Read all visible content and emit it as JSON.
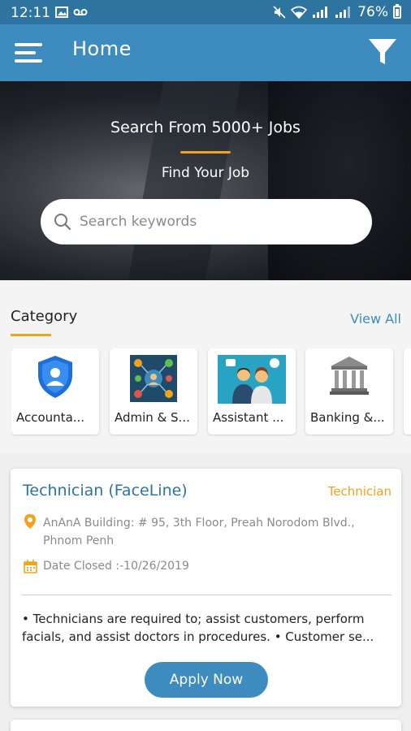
{
  "status_bar": {
    "time": "12:11",
    "battery": "76%",
    "icons": [
      "image-icon",
      "voicemail-icon",
      "mute-icon",
      "wifi-icon",
      "signal-icon",
      "battery-icon"
    ]
  },
  "app_bar": {
    "title": "Home",
    "menu_icon": "hamburger-icon",
    "filter_icon": "filter-icon",
    "color": "#3d8bbf"
  },
  "hero": {
    "title": "Search From 5000+ Jobs",
    "subtitle": "Find Your Job",
    "accent": "#f0a31b",
    "search": {
      "placeholder": "Search keywords",
      "value": ""
    }
  },
  "category": {
    "title": "Category",
    "view_all": "View All",
    "items": [
      {
        "label": "Accounta...",
        "icon": "shield-user-icon"
      },
      {
        "label": "Admin & S...",
        "icon": "admin-network-icon"
      },
      {
        "label": "Assistant ...",
        "icon": "assistant-people-icon"
      },
      {
        "label": "Banking &...",
        "icon": "bank-icon"
      }
    ]
  },
  "jobs": [
    {
      "title": "Technician (FaceLine)",
      "category": "Technician",
      "address": "AnAnA Building: # 95, 3th Floor, Preah Norodom Blvd., Phnom Penh",
      "date_closed": "Date Closed :-10/26/2019",
      "description": "• Technicians are required to; assist customers, perform facials, and assist doctors in procedures. • Customer se...",
      "apply_label": "Apply Now"
    }
  ]
}
